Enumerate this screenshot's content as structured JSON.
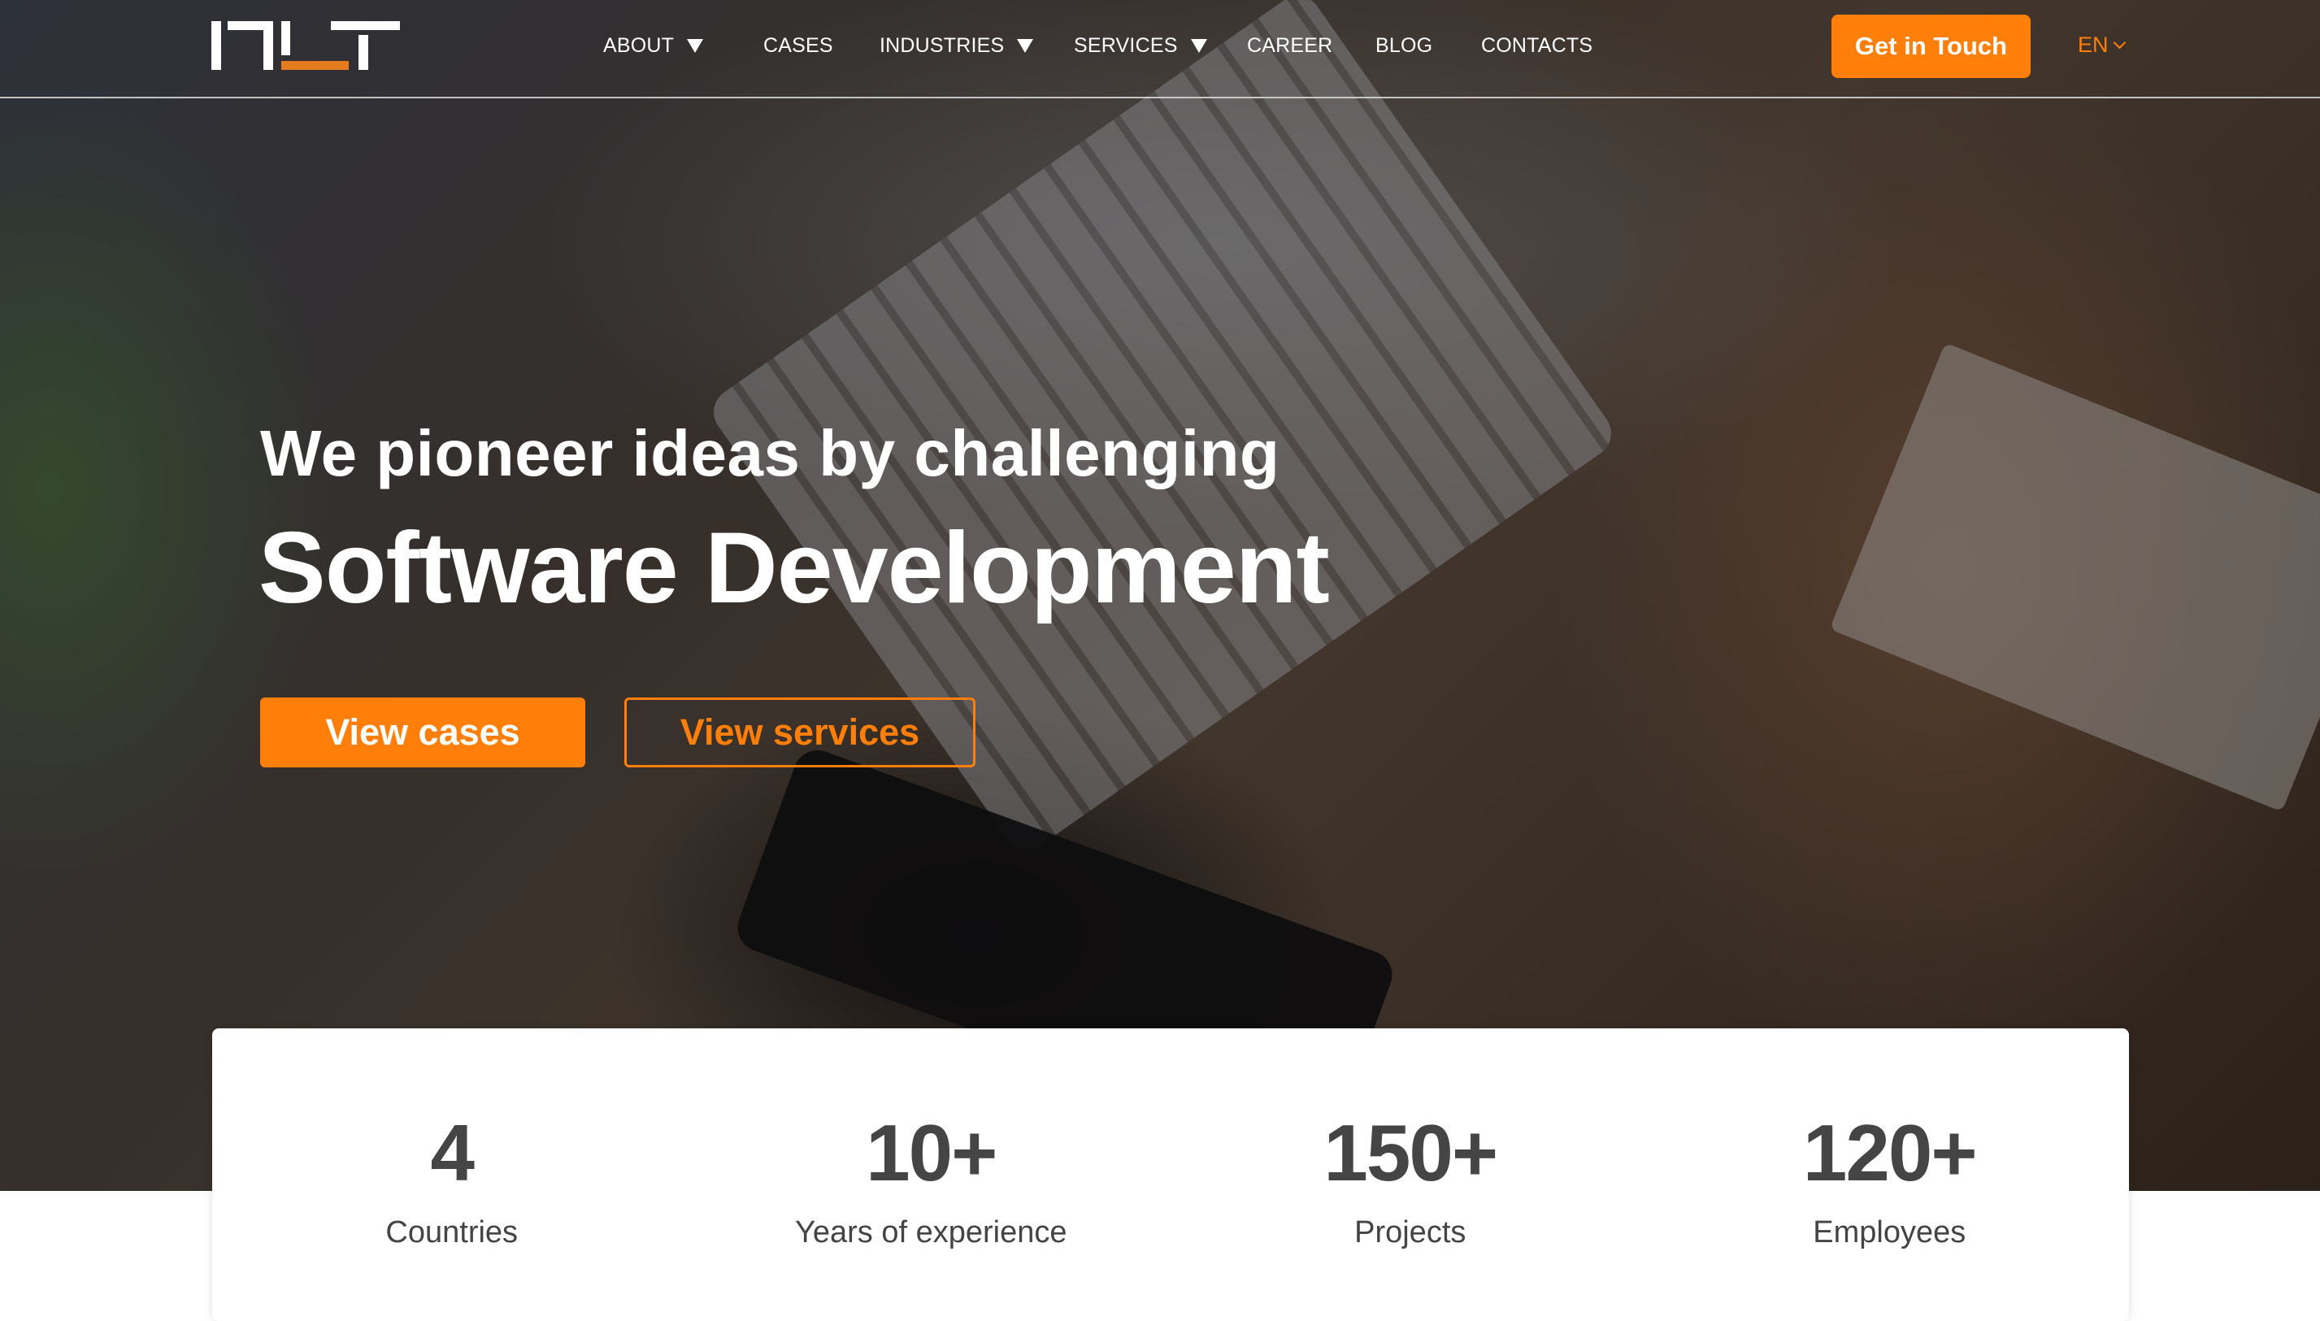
{
  "header": {
    "logo_alt": "INLT",
    "nav": [
      {
        "label": "ABOUT",
        "has_dropdown": true
      },
      {
        "label": "CASES",
        "has_dropdown": false
      },
      {
        "label": "INDUSTRIES",
        "has_dropdown": true
      },
      {
        "label": "SERVICES",
        "has_dropdown": true
      },
      {
        "label": "CAREER",
        "has_dropdown": false
      },
      {
        "label": "BLOG",
        "has_dropdown": false
      },
      {
        "label": "CONTACTS",
        "has_dropdown": false
      }
    ],
    "cta_label": "Get in Touch",
    "language": "EN"
  },
  "hero": {
    "headline_line1": "We pioneer ideas by challenging",
    "headline_line2": "Software Development",
    "primary_button": "View cases",
    "secondary_button": "View services"
  },
  "stats": [
    {
      "value": "4",
      "label": "Countries"
    },
    {
      "value": "10+",
      "label": "Years of experience"
    },
    {
      "value": "150+",
      "label": "Projects"
    },
    {
      "value": "120+",
      "label": "Employees"
    }
  ],
  "colors": {
    "accent": "#ff7f0a",
    "logo_accent": "#e57b1f",
    "stat_text": "#454545"
  }
}
